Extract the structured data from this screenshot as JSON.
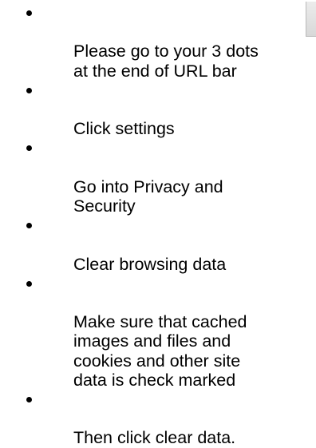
{
  "instructions": [
    "Please go to your 3 dots\nat the end of URL bar",
    "Click settings",
    "Go into Privacy and\nSecurity",
    "Clear browsing data",
    "Make sure that cached\nimages and files and\ncookies and other site\ndata is check marked",
    "Then click clear data."
  ]
}
